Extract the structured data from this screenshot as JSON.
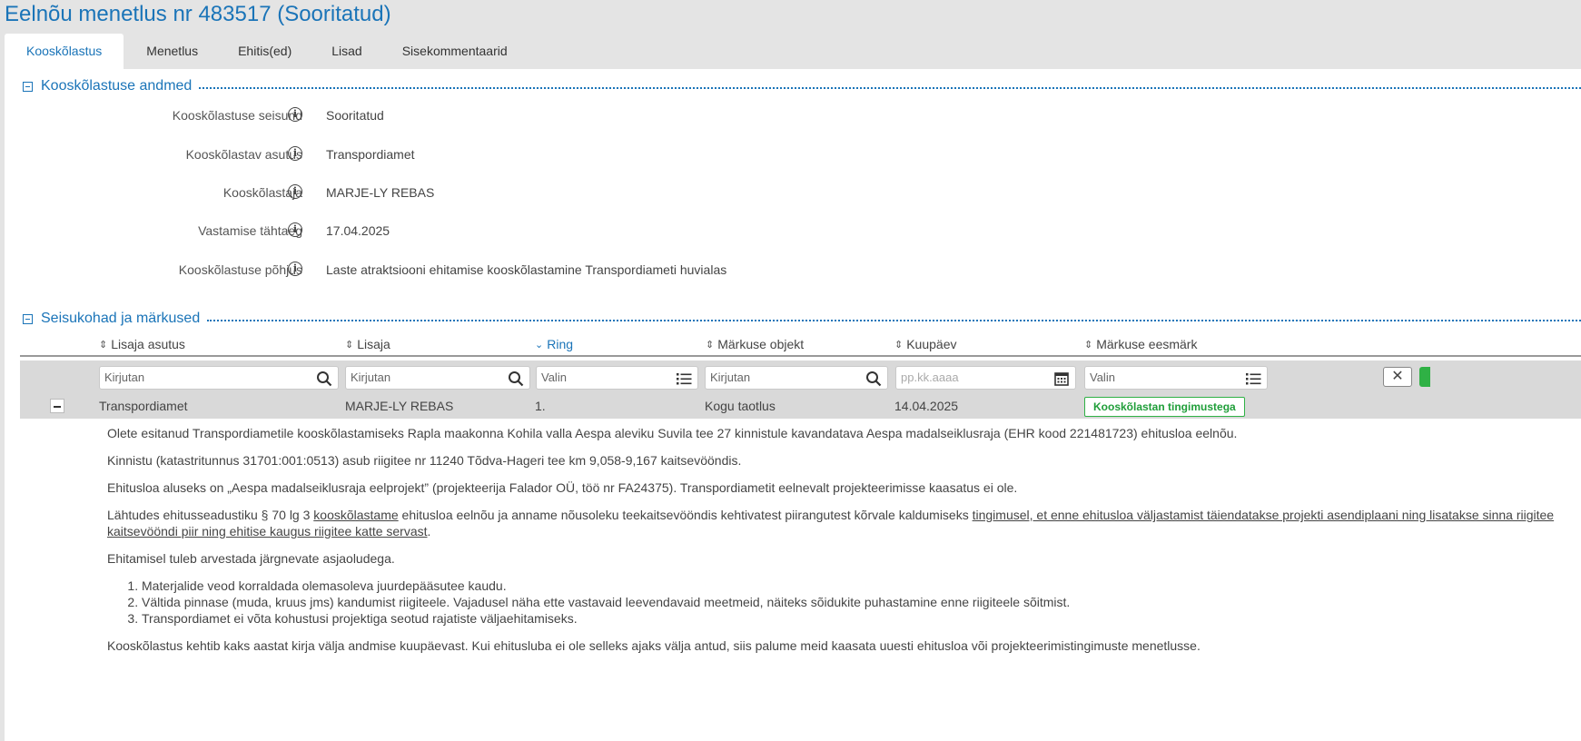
{
  "page": {
    "title": "Eelnõu menetlus nr 483517 (Sooritatud)"
  },
  "tabs": [
    {
      "label": "Kooskõlastus",
      "active": true
    },
    {
      "label": "Menetlus",
      "active": false
    },
    {
      "label": "Ehitis(ed)",
      "active": false
    },
    {
      "label": "Lisad",
      "active": false
    },
    {
      "label": "Sisekommentaarid",
      "active": false
    }
  ],
  "section1": {
    "title": "Kooskõlastuse andmed",
    "fields": [
      {
        "label": "Kooskõlastuse seisund",
        "value": "Sooritatud"
      },
      {
        "label": "Kooskõlastav asutus",
        "value": "Transpordiamet"
      },
      {
        "label": "Kooskõlastaja",
        "value": "MARJE-LY REBAS"
      },
      {
        "label": "Vastamise tähtaeg",
        "value": "17.04.2025"
      },
      {
        "label": "Kooskõlastuse põhjus",
        "value": "Laste atraktsiooni ehitamise kooskõlastamine Transpordiameti huvialas"
      }
    ]
  },
  "section2": {
    "title": "Seisukohad ja märkused",
    "columns": [
      {
        "label": "Lisaja asutus",
        "sorted": false
      },
      {
        "label": "Lisaja",
        "sorted": false
      },
      {
        "label": "Ring",
        "sorted": true
      },
      {
        "label": "Märkuse objekt",
        "sorted": false
      },
      {
        "label": "Kuupäev",
        "sorted": false
      },
      {
        "label": "Märkuse eesmärk",
        "sorted": false
      }
    ],
    "filters": [
      {
        "placeholder": "Kirjutan",
        "icon": "search-icon"
      },
      {
        "placeholder": "Kirjutan",
        "icon": "search-icon"
      },
      {
        "placeholder": "Valin",
        "icon": "list-icon"
      },
      {
        "placeholder": "Kirjutan",
        "icon": "search-icon"
      },
      {
        "placeholder": "pp.kk.aaaa",
        "icon": "calendar-icon"
      },
      {
        "placeholder": "Valin",
        "icon": "list-icon"
      }
    ],
    "clear_label": "✕",
    "row": {
      "asutus": "Transpordiamet",
      "lisaja": "MARJE-LY REBAS",
      "ring": "1.",
      "objekt": "Kogu taotlus",
      "kuupaev": "14.04.2025",
      "eesmark": "Kooskõlastan tingimustega"
    },
    "detail": {
      "p1": "Olete esitanud Transpordiametile kooskõlastamiseks Rapla maakonna Kohila valla Aespa aleviku Suvila tee 27 kinnistule kavandatava Aespa madalseiklusraja (EHR kood 221481723) ehitusloa eelnõu.",
      "p2": "Kinnistu (katastritunnus 31701:001:0513) asub riigitee nr 11240 Tõdva-Hageri tee km 9,058-9,167 kaitsevööndis.",
      "p3": "Ehitusloa aluseks on „Aespa madalseiklusraja eelprojekt” (projekteerija Falador OÜ, töö nr FA24375). Transpordiametit eelnevalt projekteerimisse kaasatus ei ole.",
      "p4_a": "Lähtudes ehitusseadustiku § 70 lg 3 ",
      "p4_link1": "kooskõlastame",
      "p4_b": " ehitusloa eelnõu ja anname nõusoleku teekaitsevööndis kehtivatest piirangutest kõrvale kaldumiseks ",
      "p4_link2": "tingimusel, et enne ehitusloa väljastamist täiendatakse projekti asendiplaani ning lisatakse sinna riigitee kaitsevööndi piir ning ehitise kaugus riigitee katte servast",
      "p4_c": ".",
      "p5": "Ehitamisel tuleb arvestada järgnevate asjaoludega.",
      "list": [
        "Materjalide veod korraldada olemasoleva juurdepääsutee kaudu.",
        "Vältida pinnase (muda, kruus jms) kandumist riigiteele. Vajadusel näha ette vastavaid leevendavaid meetmeid, näiteks sõidukite puhastamine enne riigiteele sõitmist.",
        "Transpordiamet ei võta kohustusi projektiga seotud rajatiste väljaehitamiseks."
      ],
      "p6": "Kooskõlastus kehtib kaks aastat kirja välja andmise kuupäevast. Kui ehitusluba ei ole selleks ajaks välja antud, siis palume meid kaasata uuesti ehitusloa või projekteerimistingimuste menetlusse."
    }
  },
  "colors": {
    "accent": "#1a74b8",
    "success": "#2fb145",
    "bar": "#d9d9d9"
  }
}
